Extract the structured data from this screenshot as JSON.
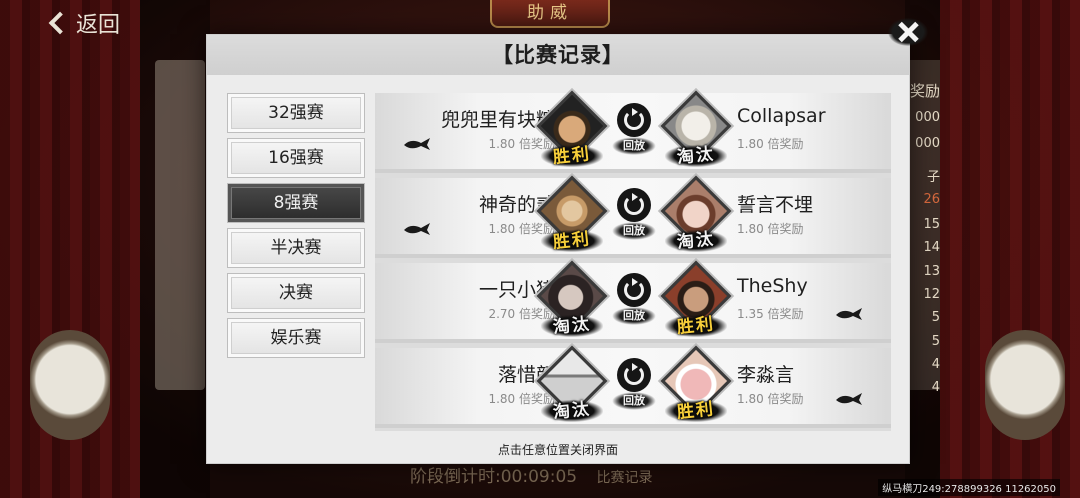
{
  "background": {
    "back_label": "返回",
    "top_banner": "助威",
    "bottom_text": "阶段倒计时:00:09:05",
    "bottom_button": "比赛记录",
    "right_col": {
      "header": "奖励",
      "values_top": [
        "000",
        "000"
      ],
      "mark": "子",
      "numbers": [
        "26",
        "15",
        "14",
        "13",
        "12",
        "5",
        "5",
        "4",
        "4"
      ]
    },
    "watermark": "纵马横刀249:278899326 11262050"
  },
  "modal": {
    "title": "【比赛记录】",
    "footer_hint": "点击任意位置关闭界面",
    "tabs": [
      {
        "label": "32强赛",
        "active": false
      },
      {
        "label": "16强赛",
        "active": false
      },
      {
        "label": "8强赛",
        "active": true
      },
      {
        "label": "半决赛",
        "active": false
      },
      {
        "label": "决赛",
        "active": false
      },
      {
        "label": "娱乐赛",
        "active": false
      }
    ],
    "replay_label": "回放",
    "stamps": {
      "win": "胜利",
      "lose": "淘汰"
    },
    "matches": [
      {
        "left": {
          "name": "兜兜里有块糖",
          "rate": "1.80 倍奖励",
          "result": "胜利",
          "won": true,
          "bet": true
        },
        "right": {
          "name": "Collapsar",
          "rate": "1.80 倍奖励",
          "result": "淘汰",
          "won": false,
          "bet": false
        }
      },
      {
        "left": {
          "name": "神奇的贰",
          "rate": "1.80 倍奖励",
          "result": "胜利",
          "won": true,
          "bet": true
        },
        "right": {
          "name": "誓言不埋",
          "rate": "1.80 倍奖励",
          "result": "淘汰",
          "won": false,
          "bet": false
        }
      },
      {
        "left": {
          "name": "一只小猪",
          "rate": "2.70 倍奖励",
          "result": "淘汰",
          "won": false,
          "bet": false
        },
        "right": {
          "name": "TheShy",
          "rate": "1.35 倍奖励",
          "result": "胜利",
          "won": true,
          "bet": true
        }
      },
      {
        "left": {
          "name": "落惜颜",
          "rate": "1.80 倍奖励",
          "result": "淘汰",
          "won": false,
          "bet": false
        },
        "right": {
          "name": "李淼言",
          "rate": "1.80 倍奖励",
          "result": "胜利",
          "won": true,
          "bet": true
        }
      }
    ]
  },
  "colors": {
    "win_stamp": "#f7cf3a",
    "lose_stamp": "#f3f3f3",
    "active_tab": "#333333",
    "modal_bg": "#ececec"
  },
  "icons": {
    "close": "close-icon",
    "replay": "replay-icon",
    "bet_marker": "fish-icon",
    "back": "chevron-left-icon"
  }
}
